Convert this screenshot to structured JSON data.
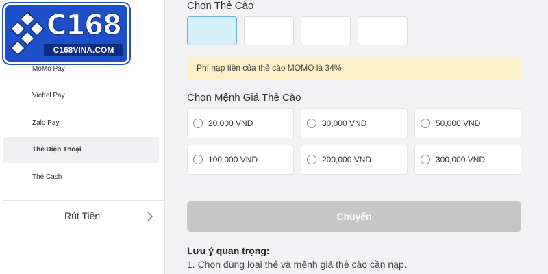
{
  "brand": {
    "logo_text": "C168",
    "logo_domain": "C168VINA.COM",
    "primary_color": "#1d50c8",
    "dark_color": "#0c2d84"
  },
  "sidebar": {
    "items": [
      {
        "label": "MoMo Pay",
        "active": false
      },
      {
        "label": "Viettel Pay",
        "active": false
      },
      {
        "label": "Zalo Pay",
        "active": false
      },
      {
        "label": "Thẻ Điện Thoại",
        "active": true
      },
      {
        "label": "Thẻ Cash",
        "active": false
      }
    ],
    "withdraw_label": "Rút Tiền",
    "withdraw_icon": "chevron-right-icon"
  },
  "main": {
    "card_section_title": "Chọn Thẻ Cào",
    "notice": "Phí nạp tiền của thẻ cào MOMO là 34%",
    "notice_color": "#fbf1c8",
    "denomination_title": "Chọn Mệnh Giá Thẻ Cào",
    "denominations": [
      "20,000 VND",
      "30,000 VND",
      "50,000 VND",
      "100,000 VND",
      "200,000 VND",
      "300,000 VND"
    ],
    "submit_label": "Chuyển",
    "submit_color": "#c6c6c6",
    "note_title": "Lưu ý quan trọng:",
    "note_lines": [
      "1. Chọn đúng loại thẻ và mệnh giá thẻ cào cần nạp."
    ]
  }
}
